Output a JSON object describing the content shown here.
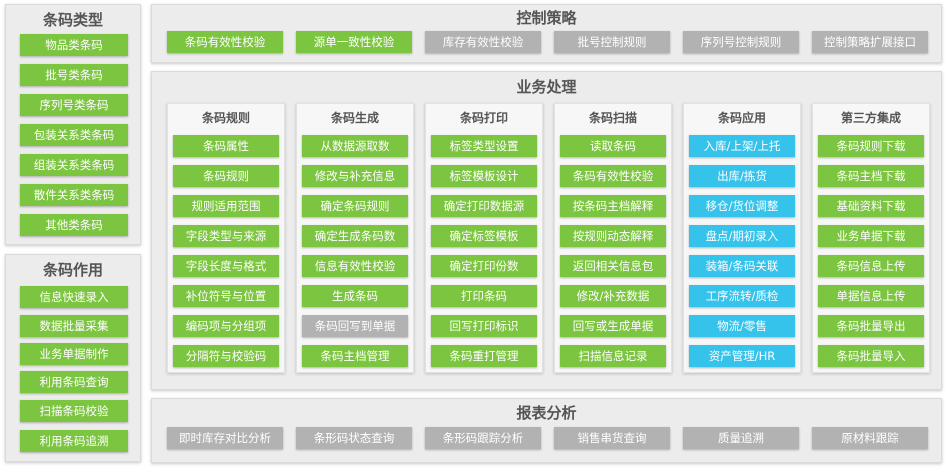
{
  "colors": {
    "green": "#7cc540",
    "silver": "#b2b2b2",
    "blue": "#35c3ec",
    "panel": "#ececec"
  },
  "barcode_types": {
    "title": "条码类型",
    "items": [
      "物品类条码",
      "批号类条码",
      "序列号类条码",
      "包装关系类条码",
      "组装关系类条码",
      "散件关系类条码",
      "其他类条码"
    ]
  },
  "barcode_roles": {
    "title": "条码作用",
    "items": [
      "信息快速录入",
      "数据批量采集",
      "业务单据制作",
      "利用条码查询",
      "扫描条码校验",
      "利用条码追溯"
    ]
  },
  "control": {
    "title": "控制策略",
    "items": [
      "条码有效性校验",
      "源单一致性校验",
      "库存有效性校验",
      "批号控制规则",
      "序列号控制规则",
      "控制策略扩展接口"
    ]
  },
  "business": {
    "title": "业务处理",
    "columns": [
      {
        "title": "条码规则",
        "items": [
          "条码属性",
          "条码规则",
          "规则适用范围",
          "字段类型与来源",
          "字段长度与格式",
          "补位符号与位置",
          "编码项与分组项",
          "分隔符与校验码"
        ]
      },
      {
        "title": "条码生成",
        "items": [
          "从数据源取数",
          "修改与补充信息",
          "确定条码规则",
          "确定生成条码数",
          "信息有效性校验",
          "生成条码",
          "条码回写到单据",
          "条码主档管理"
        ]
      },
      {
        "title": "条码打印",
        "items": [
          "标签类型设置",
          "标签模板设计",
          "确定打印数据源",
          "确定标签模板",
          "确定打印份数",
          "打印条码",
          "回写打印标识",
          "条码重打管理"
        ]
      },
      {
        "title": "条码扫描",
        "items": [
          "读取条码",
          "条码有效性校验",
          "按条码主档解释",
          "按规则动态解释",
          "返回相关信息包",
          "修改/补充数据",
          "回写或生成单据",
          "扫描信息记录"
        ]
      },
      {
        "title": "条码应用",
        "items": [
          "入库/上架/上托",
          "出库/拣货",
          "移仓/货位调整",
          "盘点/期初录入",
          "装箱/条码关联",
          "工序流转/质检",
          "物流/零售",
          "资产管理/HR"
        ]
      },
      {
        "title": "第三方集成",
        "items": [
          "条码规则下载",
          "条码主档下载",
          "基础资料下载",
          "业务单据下载",
          "条码信息上传",
          "单据信息上传",
          "条码批量导出",
          "条码批量导入"
        ]
      }
    ]
  },
  "report": {
    "title": "报表分析",
    "items": [
      "即时库存对比分析",
      "条形码状态查询",
      "条形码跟踪分析",
      "销售串货查询",
      "质量追溯",
      "原材料跟踪"
    ]
  }
}
